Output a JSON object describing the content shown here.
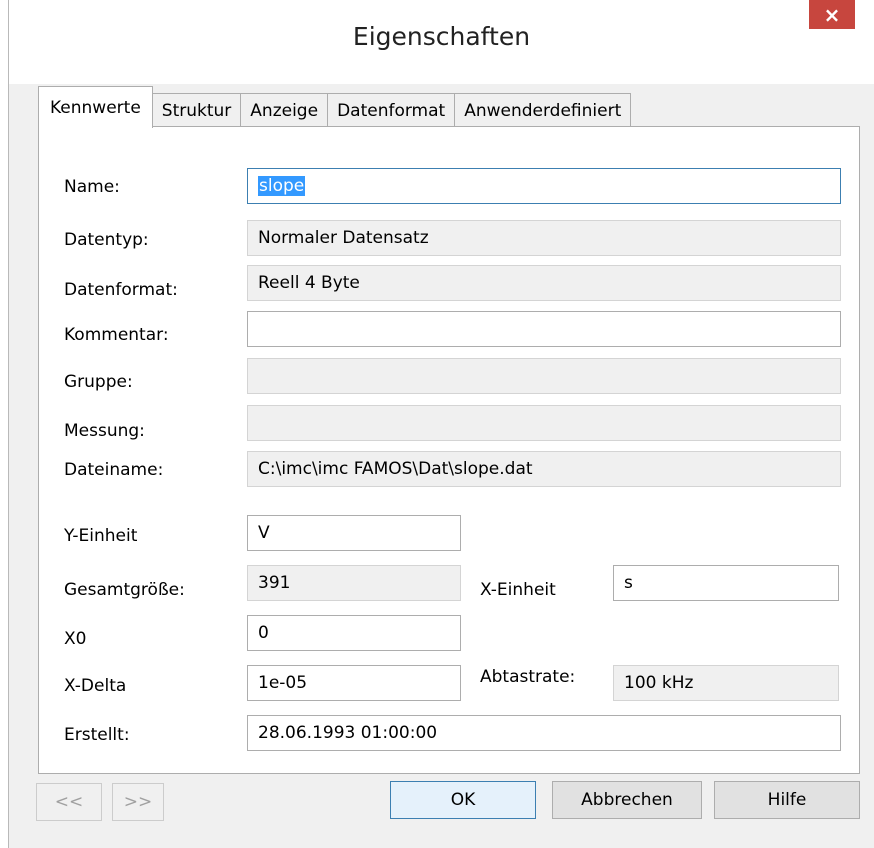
{
  "window": {
    "title": "Eigenschaften",
    "close_glyph": "×"
  },
  "tabs": [
    {
      "label": "Kennwerte",
      "active": true
    },
    {
      "label": "Struktur"
    },
    {
      "label": "Anzeige"
    },
    {
      "label": "Datenformat"
    },
    {
      "label": "Anwenderdefiniert"
    }
  ],
  "fields": {
    "name": {
      "label": "Name:",
      "value": "slope"
    },
    "datentyp": {
      "label": "Datentyp:",
      "value": "Normaler Datensatz"
    },
    "datenformat": {
      "label": "Datenformat:",
      "value": "Reell 4 Byte"
    },
    "kommentar": {
      "label": "Kommentar:",
      "value": ""
    },
    "gruppe": {
      "label": "Gruppe:",
      "value": ""
    },
    "messung": {
      "label": "Messung:",
      "value": ""
    },
    "dateiname": {
      "label": "Dateiname:",
      "value": "C:\\imc\\imc FAMOS\\Dat\\slope.dat"
    },
    "y_einheit": {
      "label": "Y-Einheit",
      "value": "V"
    },
    "gesamtgroesse": {
      "label": "Gesamtgröße:",
      "value": "391"
    },
    "x_einheit": {
      "label": "X-Einheit",
      "value": "s"
    },
    "x0": {
      "label": "X0",
      "value": "0"
    },
    "x_delta": {
      "label": "X-Delta",
      "value": "1e-05"
    },
    "abtastrate": {
      "label": "Abtastrate:",
      "value": "100 kHz"
    },
    "erstellt": {
      "label": "Erstellt:",
      "value": "28.06.1993 01:00:00"
    }
  },
  "buttons": {
    "prev": "<<",
    "next": ">>",
    "ok": "OK",
    "cancel": "Abbrechen",
    "help": "Hilfe"
  }
}
